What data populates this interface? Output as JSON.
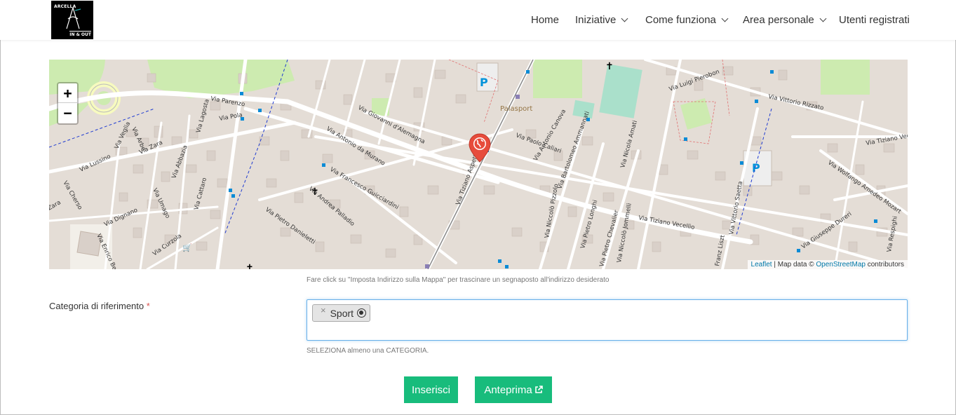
{
  "logo": {
    "line1": "ARCELLA",
    "line2": "IN & OUT"
  },
  "nav": {
    "items": [
      {
        "label": "Home",
        "dropdown": false
      },
      {
        "label": "Iniziative",
        "dropdown": true
      },
      {
        "label": "Come funziona",
        "dropdown": true
      },
      {
        "label": "Area personale",
        "dropdown": true
      },
      {
        "label": "Utenti registrati",
        "dropdown": false
      }
    ]
  },
  "map": {
    "zoom_in": "+",
    "zoom_out": "−",
    "street_labels": [
      "Via Parenzo",
      "Via Pola",
      "Via Lussino",
      "Via Veglia",
      "Via Zara",
      "Via Arbe",
      "Via Abbazia",
      "Via Lagosta",
      "Via Cherso",
      "Zara",
      "Via Umago",
      "Via Cattaro",
      "Via Dignano",
      "Via Curzola",
      "Via Enrico Bernardi",
      "Via Antonio da Murano",
      "Via Francesco Guicciardini",
      "Via Andrea Palladio",
      "Via Pietro Danieletti",
      "Via Giovanni d'Alemagna",
      "Via Tiziano Aspetti",
      "Via Paolo Caliari",
      "Via Antonio Canova",
      "Via Bartolomeo Ammannati",
      "Via Nicola Amati",
      "Via Niccolò Pizzolo",
      "Via Pietro Longhi",
      "Via Pietro Chevalier",
      "Via Niccolò Jommelli",
      "Via Tiziano Vecellio",
      "Via Luigi Pierobon",
      "Via Vittorio Rizzato",
      "Via Wolfango Amedeo Mozart",
      "Via Vittorio Saetta",
      "Via Giuseppe Dureri",
      "Franz Liszt",
      "Via Tiziano Vecellio",
      "Via Respighi",
      "Palasport"
    ],
    "attribution": {
      "leaflet": "Leaflet",
      "sep": " | Map data © ",
      "osm": "OpenStreetMap",
      "suffix": " contributors"
    },
    "hint": "Fare click su \"Imposta Indirizzo sulla Mappa\" per trascinare un segnaposto all'indirizzo desiderato"
  },
  "form": {
    "category_label": "Categoria di riferimento",
    "required_mark": "*",
    "selected": [
      {
        "remove": "×",
        "label": "Sport"
      }
    ],
    "help": "SELEZIONA almeno una CATEGORIA."
  },
  "buttons": {
    "insert": "Inserisci",
    "preview": "Anteprima"
  },
  "colors": {
    "accent": "#18bc7c",
    "focus_border": "#66afe9",
    "marker": "#e74c3c",
    "map_bg": "#e4ddd6"
  }
}
